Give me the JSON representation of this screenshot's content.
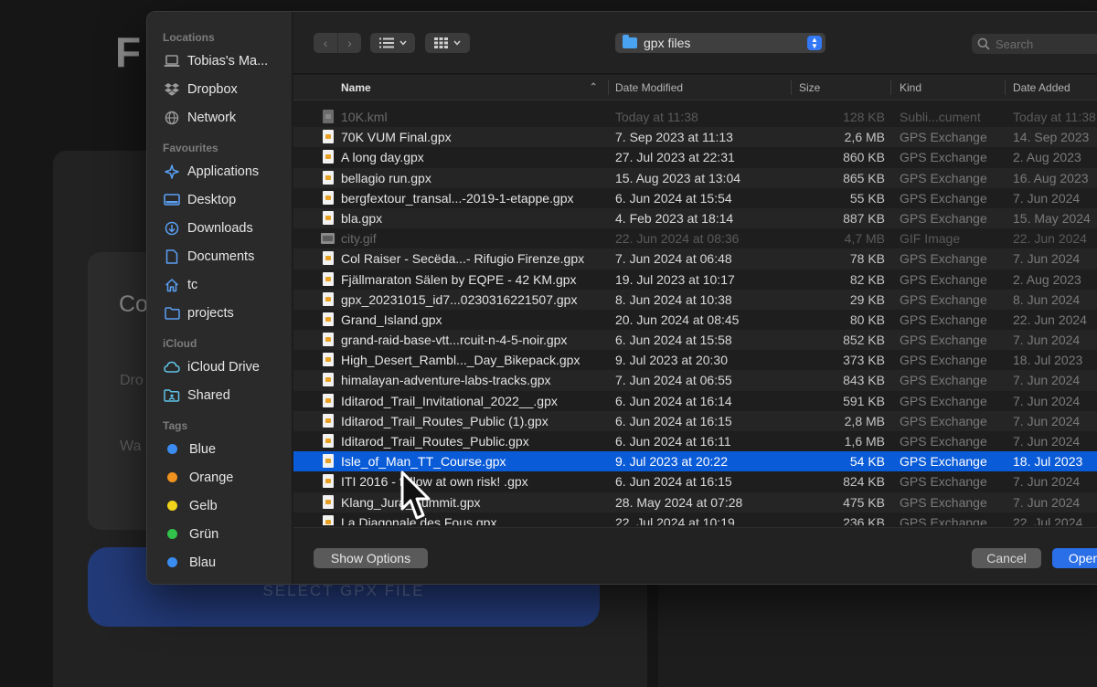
{
  "background": {
    "heading": "F",
    "card_title": "Co Ins",
    "card_text_1": "Dro cor",
    "card_text_2": "Wa int",
    "select_button": "SELECT GPX FILE"
  },
  "sidebar": {
    "sections": [
      {
        "title": "Locations",
        "items": [
          {
            "label": "Tobias's Ma...",
            "icon": "laptop-icon"
          },
          {
            "label": "Dropbox",
            "icon": "dropbox-icon"
          },
          {
            "label": "Network",
            "icon": "network-globe-icon"
          }
        ]
      },
      {
        "title": "Favourites",
        "items": [
          {
            "label": "Applications",
            "icon": "applications-icon"
          },
          {
            "label": "Desktop",
            "icon": "desktop-icon"
          },
          {
            "label": "Downloads",
            "icon": "downloads-icon"
          },
          {
            "label": "Documents",
            "icon": "documents-icon"
          },
          {
            "label": "tc",
            "icon": "home-icon"
          },
          {
            "label": "projects",
            "icon": "folder-icon"
          }
        ]
      },
      {
        "title": "iCloud",
        "items": [
          {
            "label": "iCloud Drive",
            "icon": "cloud-icon"
          },
          {
            "label": "Shared",
            "icon": "shared-folder-icon"
          }
        ]
      },
      {
        "title": "Tags",
        "tags": [
          {
            "label": "Blue",
            "color": "#3a8cf0"
          },
          {
            "label": "Orange",
            "color": "#f0921e"
          },
          {
            "label": "Gelb",
            "color": "#f2d31c"
          },
          {
            "label": "Grün",
            "color": "#30c24a"
          },
          {
            "label": "Blau",
            "color": "#3a8cf0"
          }
        ]
      }
    ]
  },
  "toolbar": {
    "location": "gpx files",
    "search_placeholder": "Search"
  },
  "columns": {
    "name": "Name",
    "date_modified": "Date Modified",
    "size": "Size",
    "kind": "Kind",
    "date_added": "Date Added"
  },
  "files": [
    {
      "name": "10K.kml",
      "date": "Today at 11:38",
      "size": "128 KB",
      "kind": "Subli...cument",
      "added": "Today at 11:38",
      "dim": true
    },
    {
      "name": "70K VUM Final.gpx",
      "date": "7. Sep 2023 at 11:13",
      "size": "2,6 MB",
      "kind": "GPS Exchange",
      "added": "14. Sep 2023"
    },
    {
      "name": "A long day.gpx",
      "date": "27. Jul 2023 at 22:31",
      "size": "860 KB",
      "kind": "GPS Exchange",
      "added": "2. Aug 2023"
    },
    {
      "name": "bellagio run.gpx",
      "date": "15. Aug 2023 at 13:04",
      "size": "865 KB",
      "kind": "GPS Exchange",
      "added": "16. Aug 2023"
    },
    {
      "name": "bergfextour_transal...-2019-1-etappe.gpx",
      "date": "6. Jun 2024 at 15:54",
      "size": "55 KB",
      "kind": "GPS Exchange",
      "added": "7. Jun 2024"
    },
    {
      "name": "bla.gpx",
      "date": "4. Feb 2023 at 18:14",
      "size": "887 KB",
      "kind": "GPS Exchange",
      "added": "15. May 2024"
    },
    {
      "name": "city.gif",
      "date": "22. Jun 2024 at 08:36",
      "size": "4,7 MB",
      "kind": "GIF Image",
      "added": "22. Jun 2024",
      "dim": true,
      "image": true
    },
    {
      "name": "Col Raiser - Secëda...- Rifugio Firenze.gpx",
      "date": "7. Jun 2024 at 06:48",
      "size": "78 KB",
      "kind": "GPS Exchange",
      "added": "7. Jun 2024"
    },
    {
      "name": "Fjällmaraton Sälen by EQPE - 42 KM.gpx",
      "date": "19. Jul 2023 at 10:17",
      "size": "82 KB",
      "kind": "GPS Exchange",
      "added": "2. Aug 2023"
    },
    {
      "name": "gpx_20231015_id7...0230316221507.gpx",
      "date": "8. Jun 2024 at 10:38",
      "size": "29 KB",
      "kind": "GPS Exchange",
      "added": "8. Jun 2024"
    },
    {
      "name": "Grand_Island.gpx",
      "date": "20. Jun 2024 at 08:45",
      "size": "80 KB",
      "kind": "GPS Exchange",
      "added": "22. Jun 2024"
    },
    {
      "name": "grand-raid-base-vtt...rcuit-n-4-5-noir.gpx",
      "date": "6. Jun 2024 at 15:58",
      "size": "852 KB",
      "kind": "GPS Exchange",
      "added": "7. Jun 2024"
    },
    {
      "name": "High_Desert_Rambl..._Day_Bikepack.gpx",
      "date": "9. Jul 2023 at 20:30",
      "size": "373 KB",
      "kind": "GPS Exchange",
      "added": "18. Jul 2023"
    },
    {
      "name": "himalayan-adventure-labs-tracks.gpx",
      "date": "7. Jun 2024 at 06:55",
      "size": "843 KB",
      "kind": "GPS Exchange",
      "added": "7. Jun 2024"
    },
    {
      "name": "Iditarod_Trail_Invitational_2022__.gpx",
      "date": "6. Jun 2024 at 16:14",
      "size": "591 KB",
      "kind": "GPS Exchange",
      "added": "7. Jun 2024"
    },
    {
      "name": "Iditarod_Trail_Routes_Public (1).gpx",
      "date": "6. Jun 2024 at 16:15",
      "size": "2,8 MB",
      "kind": "GPS Exchange",
      "added": "7. Jun 2024"
    },
    {
      "name": "Iditarod_Trail_Routes_Public.gpx",
      "date": "6. Jun 2024 at 16:11",
      "size": "1,6 MB",
      "kind": "GPS Exchange",
      "added": "7. Jun 2024"
    },
    {
      "name": "Isle_of_Man_TT_Course.gpx",
      "date": "9. Jul 2023 at 20:22",
      "size": "54 KB",
      "kind": "GPS Exchange",
      "added": "18. Jul 2023",
      "selected": true
    },
    {
      "name": "ITI 2016 - follow at own risk! .gpx",
      "date": "6. Jun 2024 at 16:15",
      "size": "824 KB",
      "kind": "GPS Exchange",
      "added": "7. Jun 2024"
    },
    {
      "name": "Klang_Jura_Summit.gpx",
      "date": "28. May 2024 at 07:28",
      "size": "475 KB",
      "kind": "GPS Exchange",
      "added": "7. Jun 2024"
    },
    {
      "name": "La Diagonale des Fous.gpx",
      "date": "22. Jul 2024 at 10:19",
      "size": "236 KB",
      "kind": "GPS Exchange",
      "added": "22. Jul 2024"
    }
  ],
  "footer": {
    "show_options": "Show Options",
    "cancel": "Cancel",
    "open": "Open"
  }
}
